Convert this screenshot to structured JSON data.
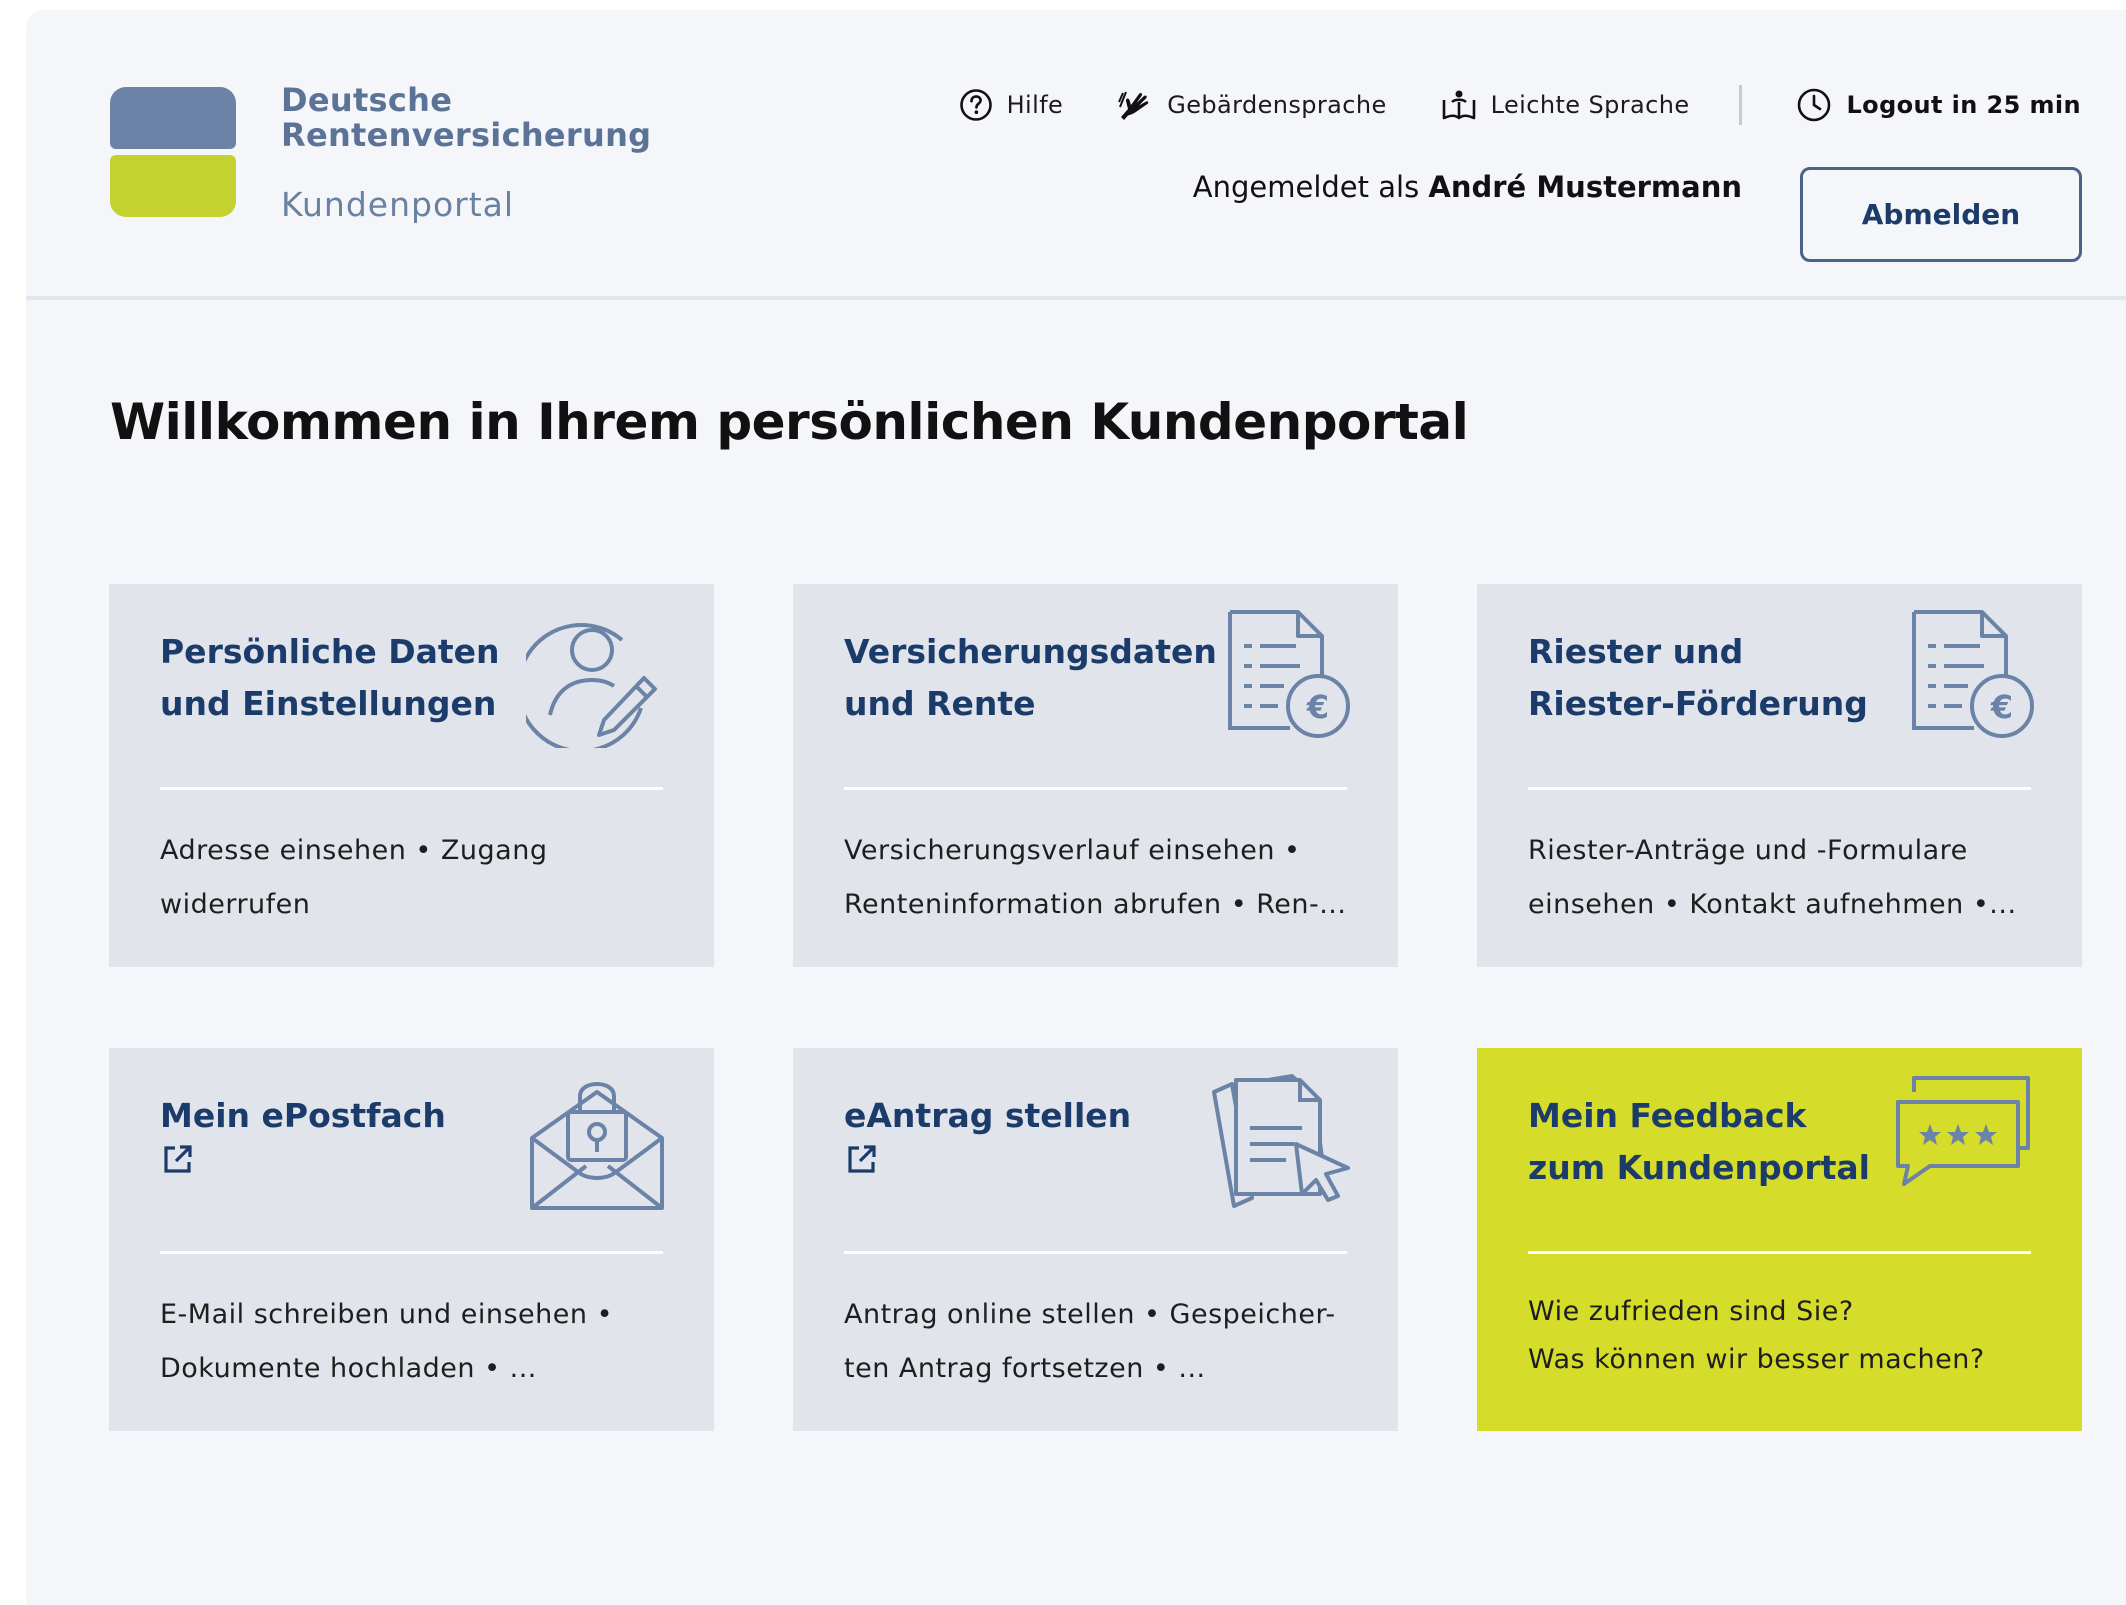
{
  "brand": {
    "line1": "Deutsche",
    "line2": "Rentenversicherung",
    "portal": "Kundenportal"
  },
  "topnav": {
    "help": "Hilfe",
    "sign_language": "Gebärdensprache",
    "easy_language": "Leichte Sprache",
    "logout_timer": "Logout in 25 min"
  },
  "session": {
    "logged_in_as": "Angemeldet als",
    "user_name": "André Mustermann",
    "logout_button": "Abmelden"
  },
  "page_title": "Willkommen in Ihrem persönlichen Kundenportal",
  "tiles": [
    {
      "title": "Persönliche Daten und Einstellungen",
      "description": "Adresse einsehen •  Zugang widerrufen",
      "icon": "user-edit-icon"
    },
    {
      "title": "Versicherungsdaten und Rente",
      "description": "Versicherungsverlauf einsehen • Renteninformation abrufen • Ren-...",
      "icon": "document-euro-icon"
    },
    {
      "title": "Riester und Riester-Förderung",
      "description": "Riester-Anträge und -Formulare einsehen • Kontakt aufnehmen •...",
      "icon": "document-euro-icon"
    },
    {
      "title": "Mein ePostfach",
      "description": "E-Mail schreiben und einsehen • Dokumente hochladen • ...",
      "icon": "locked-mail-icon",
      "external": true
    },
    {
      "title": "eAntrag stellen",
      "description": "Antrag online stellen • Gespeicher-ten Antrag fortsetzen • ...",
      "icon": "documents-cursor-icon",
      "external": true
    },
    {
      "title": "Mein Feedback zum Kundenportal",
      "description_line1": "Wie zufrieden sind Sie?",
      "description_line2": "Was können wir besser machen?",
      "icon": "rating-chat-icon",
      "highlight_color": "#d6dc2a"
    }
  ],
  "colors": {
    "brand_blue": "#6b83a6",
    "brand_green": "#c4d22f",
    "title_blue": "#1b3c6b",
    "tile_bg": "#e1e5eb",
    "page_bg": "#f4f6fa"
  }
}
